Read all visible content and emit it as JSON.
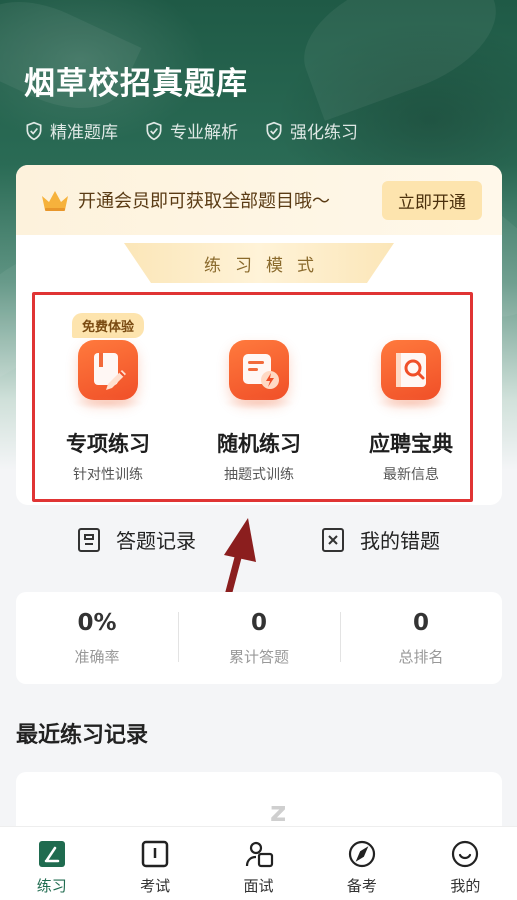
{
  "header": {
    "title": "烟草校招真题库",
    "tags": [
      "精准题库",
      "专业解析",
      "强化练习"
    ]
  },
  "vip": {
    "text": "开通会员即可获取全部题目哦～",
    "button": "立即开通"
  },
  "practice_mode": {
    "title": "练习模式",
    "free_badge": "免费体验",
    "modes": [
      {
        "name": "专项练习",
        "sub": "针对性训练",
        "icon": "note-pen-icon"
      },
      {
        "name": "随机练习",
        "sub": "抽题式训练",
        "icon": "document-bolt-icon"
      },
      {
        "name": "应聘宝典",
        "sub": "最新信息",
        "icon": "book-search-icon"
      }
    ]
  },
  "quick_links": [
    {
      "label": "答题记录",
      "icon": "record-icon"
    },
    {
      "label": "我的错题",
      "icon": "wrong-questions-icon"
    }
  ],
  "stats": [
    {
      "value": "0%",
      "label": "准确率"
    },
    {
      "value": "0",
      "label": "累计答题"
    },
    {
      "value": "0",
      "label": "总排名"
    }
  ],
  "recent": {
    "title": "最近练习记录"
  },
  "tabbar": [
    {
      "label": "练习",
      "icon": "practice-icon",
      "active": true
    },
    {
      "label": "考试",
      "icon": "exam-icon",
      "active": false
    },
    {
      "label": "面试",
      "icon": "interview-icon",
      "active": false
    },
    {
      "label": "备考",
      "icon": "compass-icon",
      "active": false
    },
    {
      "label": "我的",
      "icon": "profile-icon",
      "active": false
    }
  ],
  "colors": {
    "brand": "#1f6b4f",
    "accent": "#f04f28",
    "vip_gold": "#fde4ae",
    "highlight_box": "#e03434"
  }
}
